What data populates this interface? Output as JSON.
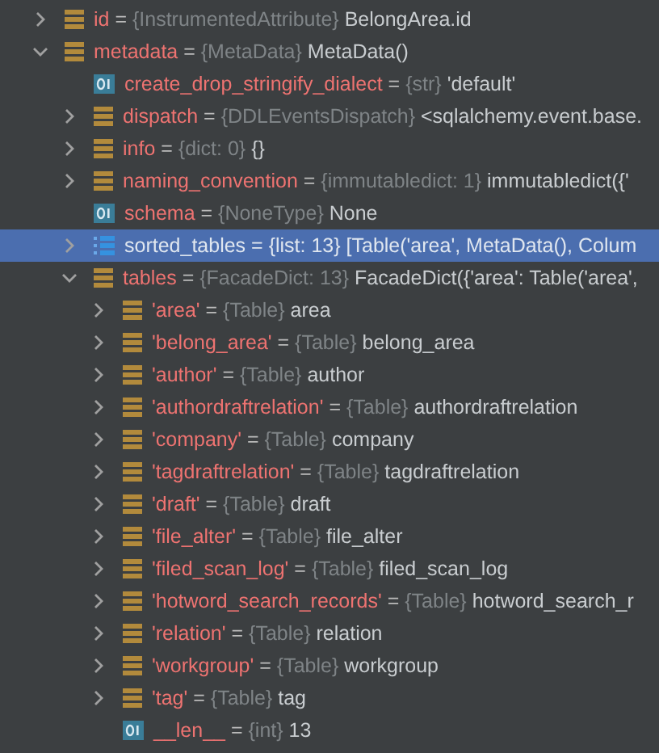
{
  "variables": [
    {
      "name": "id",
      "sep": "=",
      "type": "{InstrumentedAttribute}",
      "value": "BelongArea.id",
      "kind": "object",
      "expanded": false,
      "selected": false
    },
    {
      "name": "metadata",
      "sep": "=",
      "type": "{MetaData}",
      "value": "MetaData()",
      "kind": "object",
      "expanded": true,
      "selected": false,
      "children": [
        {
          "name": "create_drop_stringify_dialect",
          "sep": "=",
          "type": "{str}",
          "value": "'default'",
          "kind": "primitive",
          "selected": false
        },
        {
          "name": "dispatch",
          "sep": "=",
          "type": "{DDLEventsDispatch}",
          "value": "<sqlalchemy.event.base.",
          "kind": "object",
          "expanded": false,
          "selected": false
        },
        {
          "name": "info",
          "sep": "=",
          "type": "{dict: 0}",
          "value": "{}",
          "kind": "object",
          "expanded": false,
          "selected": false
        },
        {
          "name": "naming_convention",
          "sep": "=",
          "type": "{immutabledict: 1}",
          "value": "immutabledict({'",
          "kind": "object",
          "expanded": false,
          "selected": false
        },
        {
          "name": "schema",
          "sep": "=",
          "type": "{NoneType}",
          "value": "None",
          "kind": "primitive",
          "selected": false
        },
        {
          "name": "sorted_tables",
          "sep": "=",
          "type": "{list: 13}",
          "value": "[Table('area', MetaData(), Colum",
          "kind": "list",
          "expanded": false,
          "selected": true
        },
        {
          "name": "tables",
          "sep": "=",
          "type": "{FacadeDict: 13}",
          "value": "FacadeDict({'area': Table('area',",
          "kind": "object",
          "expanded": true,
          "selected": false,
          "children": [
            {
              "name": "'area'",
              "sep": "=",
              "type": "{Table}",
              "value": "area",
              "kind": "object",
              "expanded": false,
              "selected": false
            },
            {
              "name": "'belong_area'",
              "sep": "=",
              "type": "{Table}",
              "value": "belong_area",
              "kind": "object",
              "expanded": false,
              "selected": false
            },
            {
              "name": "'author'",
              "sep": "=",
              "type": "{Table}",
              "value": "author",
              "kind": "object",
              "expanded": false,
              "selected": false
            },
            {
              "name": "'authordraftrelation'",
              "sep": "=",
              "type": "{Table}",
              "value": "authordraftrelation",
              "kind": "object",
              "expanded": false,
              "selected": false
            },
            {
              "name": "'company'",
              "sep": "=",
              "type": "{Table}",
              "value": "company",
              "kind": "object",
              "expanded": false,
              "selected": false
            },
            {
              "name": "'tagdraftrelation'",
              "sep": "=",
              "type": "{Table}",
              "value": "tagdraftrelation",
              "kind": "object",
              "expanded": false,
              "selected": false
            },
            {
              "name": "'draft'",
              "sep": "=",
              "type": "{Table}",
              "value": "draft",
              "kind": "object",
              "expanded": false,
              "selected": false
            },
            {
              "name": "'file_alter'",
              "sep": "=",
              "type": "{Table}",
              "value": "file_alter",
              "kind": "object",
              "expanded": false,
              "selected": false
            },
            {
              "name": "'filed_scan_log'",
              "sep": "=",
              "type": "{Table}",
              "value": "filed_scan_log",
              "kind": "object",
              "expanded": false,
              "selected": false
            },
            {
              "name": "'hotword_search_records'",
              "sep": "=",
              "type": "{Table}",
              "value": "hotword_search_r",
              "kind": "object",
              "expanded": false,
              "selected": false
            },
            {
              "name": "'relation'",
              "sep": "=",
              "type": "{Table}",
              "value": "relation",
              "kind": "object",
              "expanded": false,
              "selected": false
            },
            {
              "name": "'workgroup'",
              "sep": "=",
              "type": "{Table}",
              "value": "workgroup",
              "kind": "object",
              "expanded": false,
              "selected": false
            },
            {
              "name": "'tag'",
              "sep": "=",
              "type": "{Table}",
              "value": "tag",
              "kind": "object",
              "expanded": false,
              "selected": false
            },
            {
              "name": "__len__",
              "sep": "=",
              "type": "{int}",
              "value": "13",
              "kind": "primitive",
              "selected": false
            }
          ]
        }
      ]
    }
  ]
}
